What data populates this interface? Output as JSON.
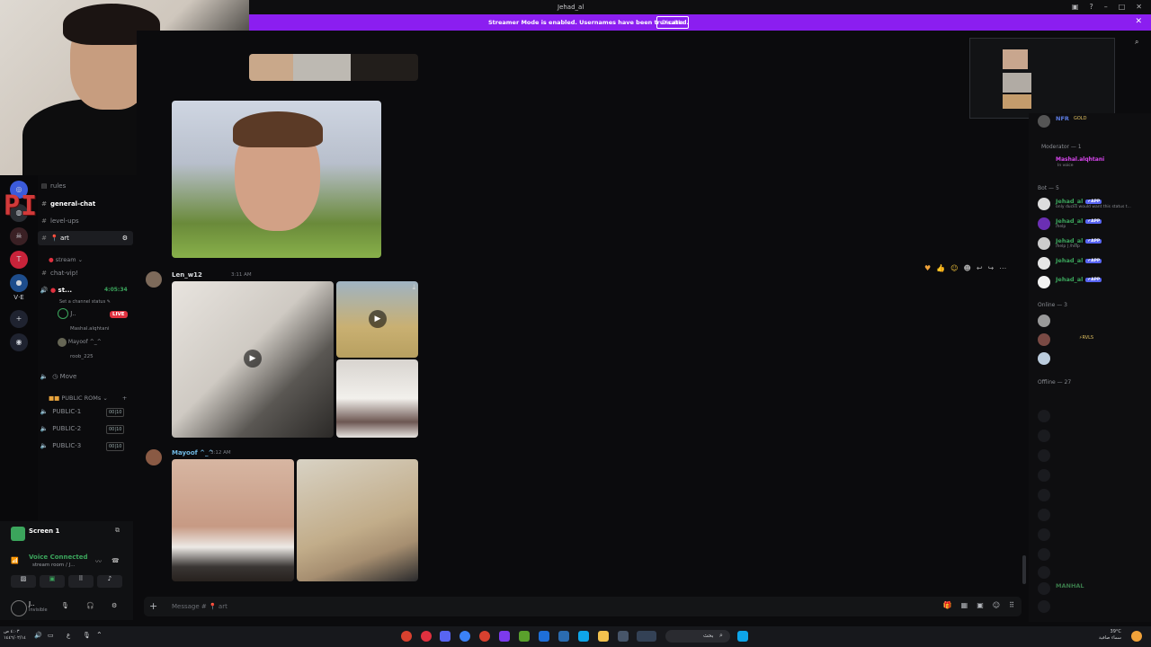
{
  "window": {
    "title": "Jehad_al"
  },
  "banner": {
    "message": "Streamer Mode is enabled. Usernames have been truncated.",
    "disable_label": "Disable"
  },
  "logo": {
    "text": "PIXL"
  },
  "channels": [
    {
      "name": "rules",
      "icon": "book-icon"
    },
    {
      "name": "general-chat",
      "icon": "hash-icon"
    },
    {
      "name": "level-ups",
      "icon": "hash-icon"
    },
    {
      "name": "art",
      "icon": "hash-icon"
    },
    {
      "name": "stream",
      "icon": "folder-icon"
    },
    {
      "name": "chat-vip!",
      "icon": "hash-icon"
    },
    {
      "name": "st...",
      "icon": "speaker-icon"
    },
    {
      "name": "Set a channel status",
      "icon": ""
    },
    {
      "name": "LIVE",
      "icon": ""
    },
    {
      "name": "Mayoof ^_^",
      "icon": ""
    },
    {
      "name": "Mashal.alqhtani",
      "icon": ""
    },
    {
      "name": "roob_225",
      "icon": ""
    },
    {
      "name": "Move",
      "icon": "speaker-icon"
    },
    {
      "name": "PUBLIC ROMs",
      "icon": ""
    },
    {
      "name": "PUBLIC-1",
      "icon": "speaker-icon"
    },
    {
      "name": "PUBLIC-2",
      "icon": "speaker-icon"
    },
    {
      "name": "PUBLIC-3",
      "icon": "speaker-icon"
    }
  ],
  "voice": {
    "timer": "4:05:34",
    "count_a": "00",
    "count_b": "10"
  },
  "userpanel": {
    "screen_title": "Screen 1",
    "voice_connected": "Voice Connected",
    "voice_channel": "stream room / J...",
    "user_status": "Invisible"
  },
  "messages": [
    {
      "author": "Len_w12",
      "time": "3:11 AM",
      "author_color": "#dbdee1"
    },
    {
      "author": "Mayoof ^_^",
      "time": "3:12 AM",
      "author_color": "#6fb8e3"
    }
  ],
  "composer": {
    "placeholder": "Message # 📍 art",
    "channel": "art"
  },
  "members": {
    "moderator_header": "Moderator — 1",
    "moderator_name": "Mashal.alqhtani",
    "moderator_sub": "In voice",
    "bot_header": "Bot — 5",
    "bots": [
      {
        "name": "Jehad_al",
        "badge": "✔APP",
        "sub": "only ducks would want this status t..."
      },
      {
        "name": "Jehad_al",
        "badge": "✔APP",
        "sub": "/help"
      },
      {
        "name": "Jehad_al",
        "badge": "✔APP",
        "sub": "/help | /help"
      },
      {
        "name": "Jehad_al",
        "badge": "✔APP",
        "sub": ""
      },
      {
        "name": "Jehad_al",
        "badge": "✔APP",
        "sub": ""
      }
    ],
    "online_header": "Online — 3",
    "online_tag": "⚡RVLS",
    "offline_header": "Offline — 27",
    "offline_named": "MANHAL",
    "top_name": "NFR",
    "top_tag": "GOLD",
    "bot_color": "#3ba55c",
    "mod_color": "#d946ef"
  },
  "taskbar": {
    "search_placeholder": "بحث",
    "weather": "39°C",
    "weather_desc": "سماء صافية",
    "time": "٤:٠٣ ص",
    "date": "١٤٤٦/٠٢/١٤"
  },
  "colors": {
    "accent": "#8b1ef0",
    "live": "#e0313f",
    "online": "#3ba55c"
  }
}
